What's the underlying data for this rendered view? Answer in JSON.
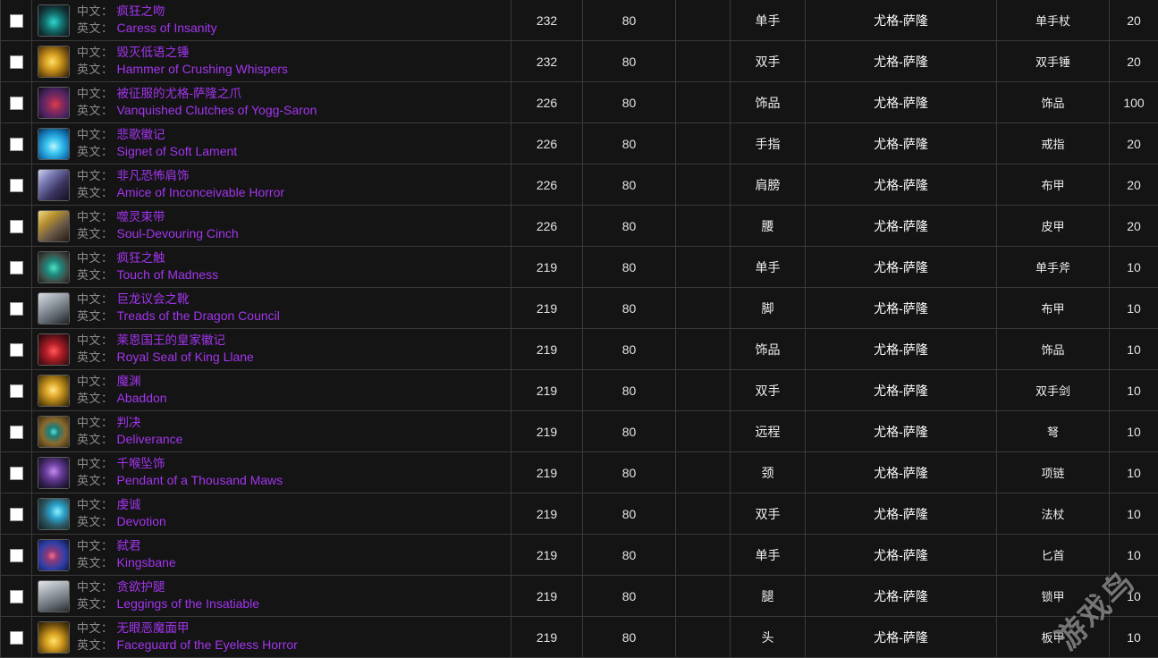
{
  "table": {
    "label_cn": "中文：",
    "label_en": "英文：",
    "checkbox_checked": false,
    "rarity_color": "#a335ee",
    "label_color": "#8c8c8c",
    "row_bg": "#141414",
    "border_color": "#3a3a3a",
    "columns": [
      {
        "key": "check",
        "header": ""
      },
      {
        "key": "item",
        "header": ""
      },
      {
        "key": "ilvl",
        "header": ""
      },
      {
        "key": "level",
        "header": ""
      },
      {
        "key": "blank",
        "header": ""
      },
      {
        "key": "slot",
        "header": ""
      },
      {
        "key": "boss",
        "header": ""
      },
      {
        "key": "type",
        "header": ""
      },
      {
        "key": "drop",
        "header": ""
      }
    ],
    "rows": [
      {
        "name_cn": "疯狂之吻",
        "name_en": "Caress of Insanity",
        "ilvl": "232",
        "level": "80",
        "blank": "",
        "slot": "单手",
        "boss": "尤格-萨隆",
        "type": "单手杖",
        "drop": "20",
        "icon": "dagger-teal",
        "icon_name": "item-icon-caress-of-insanity"
      },
      {
        "name_cn": "毁灭低语之锤",
        "name_en": "Hammer of Crushing Whispers",
        "ilvl": "232",
        "level": "80",
        "blank": "",
        "slot": "双手",
        "boss": "尤格-萨隆",
        "type": "双手锤",
        "drop": "20",
        "icon": "hammer-gold",
        "icon_name": "item-icon-hammer-of-crushing-whispers"
      },
      {
        "name_cn": "被征服的尤格-萨隆之爪",
        "name_en": "Vanquished Clutches of Yogg-Saron",
        "ilvl": "226",
        "level": "80",
        "blank": "",
        "slot": "饰品",
        "boss": "尤格-萨隆",
        "type": "饰品",
        "drop": "100",
        "icon": "claw-purple",
        "icon_name": "item-icon-vanquished-clutches"
      },
      {
        "name_cn": "悲歌徽记",
        "name_en": "Signet of Soft Lament",
        "ilvl": "226",
        "level": "80",
        "blank": "",
        "slot": "手指",
        "boss": "尤格-萨隆",
        "type": "戒指",
        "drop": "20",
        "icon": "ring-cyan",
        "icon_name": "item-icon-signet-of-soft-lament"
      },
      {
        "name_cn": "非凡恐怖肩饰",
        "name_en": "Amice of Inconceivable Horror",
        "ilvl": "226",
        "level": "80",
        "blank": "",
        "slot": "肩膀",
        "boss": "尤格-萨隆",
        "type": "布甲",
        "drop": "20",
        "icon": "shoulder-violet",
        "icon_name": "item-icon-amice-of-inconceivable-horror"
      },
      {
        "name_cn": "噬灵束带",
        "name_en": "Soul-Devouring Cinch",
        "ilvl": "226",
        "level": "80",
        "blank": "",
        "slot": "腰",
        "boss": "尤格-萨隆",
        "type": "皮甲",
        "drop": "20",
        "icon": "belt-gold",
        "icon_name": "item-icon-soul-devouring-cinch"
      },
      {
        "name_cn": "疯狂之触",
        "name_en": "Touch of Madness",
        "ilvl": "219",
        "level": "80",
        "blank": "",
        "slot": "单手",
        "boss": "尤格-萨隆",
        "type": "单手斧",
        "drop": "10",
        "icon": "axe-teal",
        "icon_name": "item-icon-touch-of-madness"
      },
      {
        "name_cn": "巨龙议会之靴",
        "name_en": "Treads of the Dragon Council",
        "ilvl": "219",
        "level": "80",
        "blank": "",
        "slot": "脚",
        "boss": "尤格-萨隆",
        "type": "布甲",
        "drop": "10",
        "icon": "boot-grey",
        "icon_name": "item-icon-treads-of-the-dragon-council"
      },
      {
        "name_cn": "莱恩国王的皇家徽记",
        "name_en": "Royal Seal of King Llane",
        "ilvl": "219",
        "level": "80",
        "blank": "",
        "slot": "饰品",
        "boss": "尤格-萨隆",
        "type": "饰品",
        "drop": "10",
        "icon": "seal-red",
        "icon_name": "item-icon-royal-seal-of-king-llane"
      },
      {
        "name_cn": "魔渊",
        "name_en": "Abaddon",
        "ilvl": "219",
        "level": "80",
        "blank": "",
        "slot": "双手",
        "boss": "尤格-萨隆",
        "type": "双手剑",
        "drop": "10",
        "icon": "sword-gold",
        "icon_name": "item-icon-abaddon"
      },
      {
        "name_cn": "判决",
        "name_en": "Deliverance",
        "ilvl": "219",
        "level": "80",
        "blank": "",
        "slot": "远程",
        "boss": "尤格-萨隆",
        "type": "弩",
        "drop": "10",
        "icon": "crossbow-brown",
        "icon_name": "item-icon-deliverance"
      },
      {
        "name_cn": "千喉坠饰",
        "name_en": "Pendant of a Thousand Maws",
        "ilvl": "219",
        "level": "80",
        "blank": "",
        "slot": "颈",
        "boss": "尤格-萨隆",
        "type": "项链",
        "drop": "10",
        "icon": "pendant-violet",
        "icon_name": "item-icon-pendant-of-a-thousand-maws"
      },
      {
        "name_cn": "虔诚",
        "name_en": "Devotion",
        "ilvl": "219",
        "level": "80",
        "blank": "",
        "slot": "双手",
        "boss": "尤格-萨隆",
        "type": "法杖",
        "drop": "10",
        "icon": "staff-cyan",
        "icon_name": "item-icon-devotion"
      },
      {
        "name_cn": "弑君",
        "name_en": "Kingsbane",
        "ilvl": "219",
        "level": "80",
        "blank": "",
        "slot": "单手",
        "boss": "尤格-萨隆",
        "type": "匕首",
        "drop": "10",
        "icon": "dagger-blue",
        "icon_name": "item-icon-kingsbane"
      },
      {
        "name_cn": "贪欲护腿",
        "name_en": "Leggings of the Insatiable",
        "ilvl": "219",
        "level": "80",
        "blank": "",
        "slot": "腿",
        "boss": "尤格-萨隆",
        "type": "锁甲",
        "drop": "10",
        "icon": "legs-silver",
        "icon_name": "item-icon-leggings-of-the-insatiable"
      },
      {
        "name_cn": "无眼恶魔面甲",
        "name_en": "Faceguard of the Eyeless Horror",
        "ilvl": "219",
        "level": "80",
        "blank": "",
        "slot": "头",
        "boss": "尤格-萨隆",
        "type": "板甲",
        "drop": "10",
        "icon": "helm-gold",
        "icon_name": "item-icon-faceguard-of-the-eyeless-horror"
      }
    ]
  },
  "watermark": {
    "text": "游戏鸟"
  }
}
